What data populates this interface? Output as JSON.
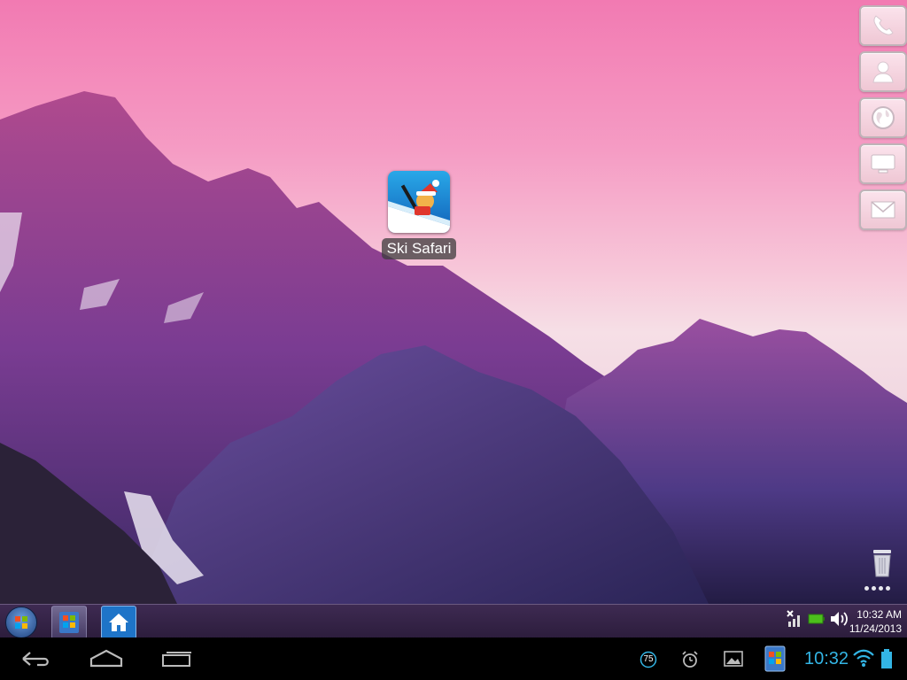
{
  "desktop": {
    "app": {
      "name": "Ski Safari",
      "icon": "ski-safari-icon"
    }
  },
  "dock": [
    {
      "name": "phone",
      "icon": "phone-icon"
    },
    {
      "name": "contacts",
      "icon": "contacts-icon"
    },
    {
      "name": "browser",
      "icon": "globe-icon"
    },
    {
      "name": "desktop",
      "icon": "monitor-icon"
    },
    {
      "name": "email",
      "icon": "mail-icon"
    }
  ],
  "taskbar": {
    "time": "10:32 AM",
    "date": "11/24/2013"
  },
  "navbar": {
    "badge_count": "75",
    "time": "10:32"
  },
  "colors": {
    "accent": "#33b5e5",
    "taskbar": "#2c1d3c"
  }
}
